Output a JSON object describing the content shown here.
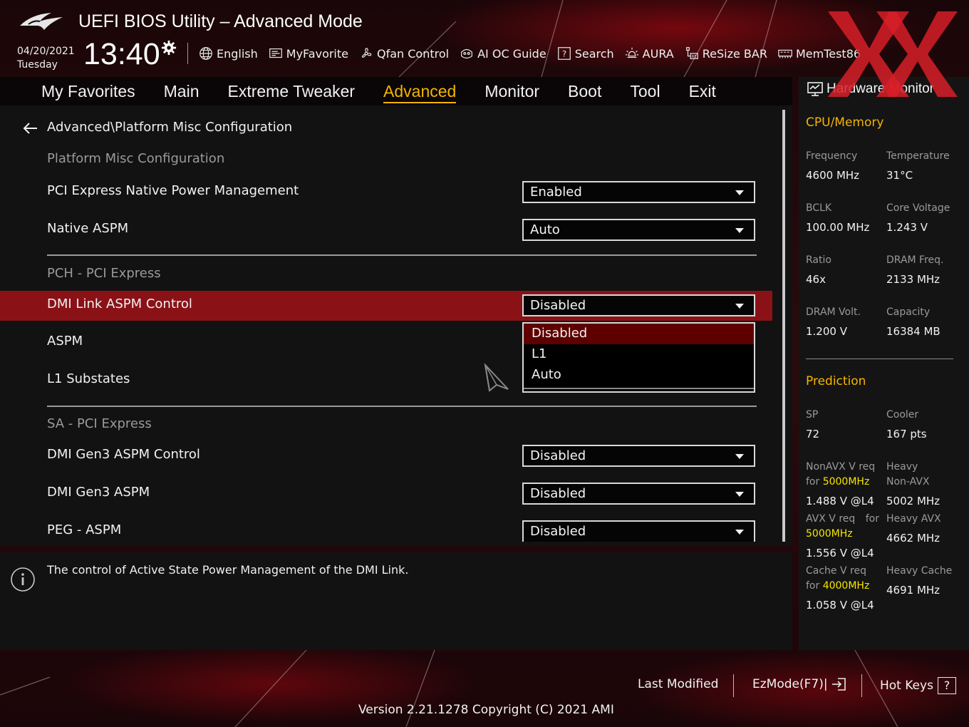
{
  "header": {
    "title": "UEFI BIOS Utility – Advanced Mode",
    "date": "04/20/2021",
    "day": "Tuesday",
    "time": "13:40",
    "toolbar": [
      {
        "name": "language-button",
        "icon": "globe-icon",
        "label": "English"
      },
      {
        "name": "myfavorite-button",
        "icon": "myfavorite-icon",
        "label": "MyFavorite"
      },
      {
        "name": "qfan-control-button",
        "icon": "fan-icon",
        "label": "Qfan Control"
      },
      {
        "name": "ai-oc-guide-button",
        "icon": "ai-oc-guide-icon",
        "label": "AI OC Guide"
      },
      {
        "name": "search-button",
        "icon": "search-help-icon",
        "label": "Search"
      },
      {
        "name": "aura-button",
        "icon": "aura-icon",
        "label": "AURA"
      },
      {
        "name": "resize-bar-button",
        "icon": "resize-bar-icon",
        "label": "ReSize BAR"
      },
      {
        "name": "memtest-button",
        "icon": "memtest-icon",
        "label": "MemTest86"
      }
    ]
  },
  "nav": {
    "tabs": [
      "My Favorites",
      "Main",
      "Extreme Tweaker",
      "Advanced",
      "Monitor",
      "Boot",
      "Tool",
      "Exit"
    ],
    "active": "Advanced"
  },
  "main": {
    "breadcrumb": "Advanced\\Platform Misc Configuration",
    "sections": {
      "platform": "Platform Misc Configuration",
      "pch": "PCH - PCI Express",
      "sa": "SA - PCI Express"
    },
    "rows": {
      "pcie_native_pm": {
        "label": "PCI Express Native Power Management",
        "value": "Enabled"
      },
      "native_aspm": {
        "label": "Native ASPM",
        "value": "Auto"
      },
      "dmi_link_aspm": {
        "label": "DMI Link ASPM Control",
        "value": "Disabled"
      },
      "aspm": {
        "label": "ASPM"
      },
      "l1_substates": {
        "label": "L1 Substates"
      },
      "dmi_gen3_aspm_control": {
        "label": "DMI Gen3 ASPM Control",
        "value": "Disabled"
      },
      "dmi_gen3_aspm": {
        "label": "DMI Gen3 ASPM",
        "value": "Disabled"
      },
      "peg_aspm": {
        "label": "PEG - ASPM",
        "value": "Disabled"
      }
    },
    "dropdown_options": [
      "Disabled",
      "L1",
      "Auto"
    ],
    "dropdown_selected": "Disabled"
  },
  "help": {
    "text": "The control of Active State Power Management of the DMI Link."
  },
  "hardware_monitor": {
    "title": "Hardware Monitor",
    "cpu_memory": {
      "heading": "CPU/Memory",
      "frequency": {
        "label": "Frequency",
        "value": "4600 MHz"
      },
      "temperature": {
        "label": "Temperature",
        "value": "31°C"
      },
      "bclk": {
        "label": "BCLK",
        "value": "100.00 MHz"
      },
      "core_voltage": {
        "label": "Core Voltage",
        "value": "1.243 V"
      },
      "ratio": {
        "label": "Ratio",
        "value": "46x"
      },
      "dram_freq": {
        "label": "DRAM Freq.",
        "value": "2133 MHz"
      },
      "dram_volt": {
        "label": "DRAM Volt.",
        "value": "1.200 V"
      },
      "capacity": {
        "label": "Capacity",
        "value": "16384 MB"
      }
    },
    "prediction": {
      "heading": "Prediction",
      "sp": {
        "label": "SP",
        "value": "72"
      },
      "cooler": {
        "label": "Cooler",
        "value": "167 pts"
      },
      "nonavx_req": {
        "label_line1": "NonAVX V req",
        "label_for": "for",
        "freq": "5000MHz",
        "value": "1.488 V @L4"
      },
      "heavy_nonavx": {
        "label_line1": "Heavy",
        "label_line2": "Non-AVX",
        "value": "5002 MHz"
      },
      "avx_req": {
        "label_line1": "AVX V req",
        "label_for": "for",
        "freq": "5000MHz",
        "value": "1.556 V @L4"
      },
      "heavy_avx": {
        "label": "Heavy AVX",
        "value": "4662 MHz"
      },
      "cache_req": {
        "label_line1": "Cache V req",
        "label_for": "for",
        "freq": "4000MHz",
        "value": "1.058 V @L4"
      },
      "heavy_cache": {
        "label": "Heavy Cache",
        "value": "4691 MHz"
      }
    }
  },
  "footer": {
    "last_modified": "Last Modified",
    "ezmode": "EzMode(F7)|",
    "hot_keys": "Hot Keys",
    "hot_keys_symbol": "?",
    "version": "Version 2.21.1278 Copyright (C) 2021 AMI"
  },
  "colors": {
    "accent": "#f5b400",
    "selected_row": "#8a1217",
    "dropdown_highlight": "#5e0000",
    "frequency_highlight": "#f5e600"
  }
}
